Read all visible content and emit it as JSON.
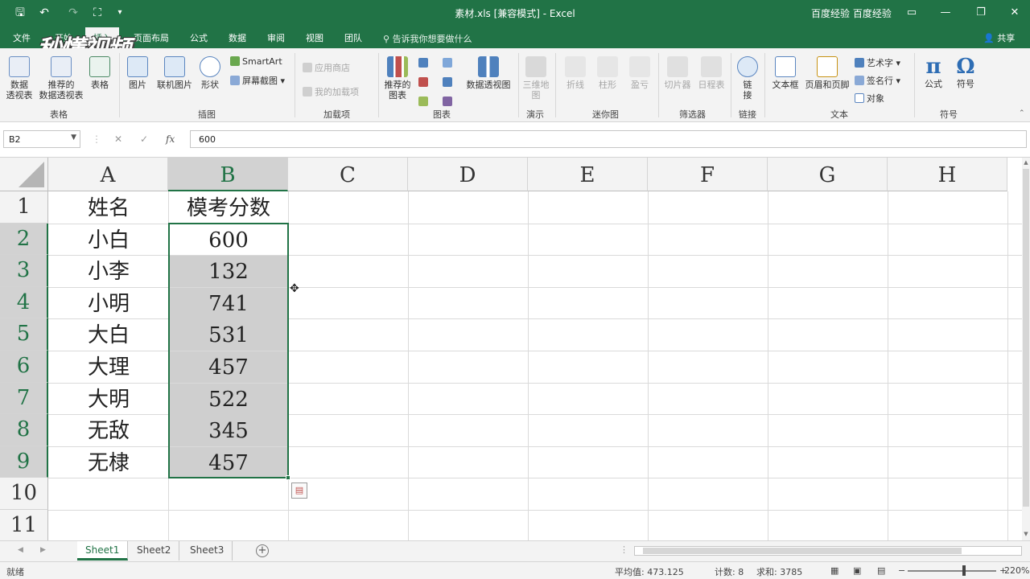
{
  "titlebar": {
    "title": "素材.xls  [兼容模式]  -  Excel",
    "user": "百度经验 百度经验",
    "quick_access": {
      "save": "🖫",
      "undo": "↶",
      "redo": "↷",
      "touch": "⛶",
      "customize": "▾"
    },
    "window": {
      "ribbon_options": "▭",
      "minimize": "—",
      "restore": "❐",
      "close": "✕"
    }
  },
  "logo_text": "秒懂视频",
  "tabs": [
    {
      "label": "文件"
    },
    {
      "label": "开始"
    },
    {
      "label": "插入"
    },
    {
      "label": "页面布局"
    },
    {
      "label": "公式"
    },
    {
      "label": "数据"
    },
    {
      "label": "审阅"
    },
    {
      "label": "视图"
    },
    {
      "label": "团队"
    }
  ],
  "tell_me": "告诉我你想要做什么",
  "share": "共享",
  "ribbon": {
    "pivot_table": "数据\n透视表",
    "recommended_pivot": "推荐的\n数据透视表",
    "table": "表格",
    "pictures": "图片",
    "online_pictures": "联机图片",
    "shapes": "形状",
    "smartart": "SmartArt",
    "screenshot": "屏幕截图 ▾",
    "app_store": "应用商店",
    "my_addins": "我的加载项",
    "recommended_charts": "推荐的\n图表",
    "pivot_chart": "数据透视图",
    "map_3d": "三维地\n图",
    "sparkline_line": "折线",
    "sparkline_column": "柱形",
    "sparkline_winloss": "盈亏",
    "slicer": "切片器",
    "timeline": "日程表",
    "link": "链\n接",
    "textbox": "文本框",
    "header_footer": "页眉和页脚",
    "wordart": "艺术字 ▾",
    "signature": "签名行 ▾",
    "object": "对象",
    "equation": "公式",
    "symbol": "符号",
    "equation_glyph": "π",
    "symbol_glyph": "Ω",
    "groups": {
      "tables": "表格",
      "illustrations": "插图",
      "addins": "加载项",
      "charts": "图表",
      "tours": "演示",
      "sparklines": "迷你图",
      "filters": "筛选器",
      "links": "链接",
      "text": "文本",
      "symbols": "符号"
    }
  },
  "formula_bar": {
    "name_box": "B2",
    "value": "600",
    "cancel": "✕",
    "enter": "✓",
    "fx": "fx"
  },
  "columns": [
    "A",
    "B",
    "C",
    "D",
    "E",
    "F",
    "G",
    "H"
  ],
  "rows": [
    "1",
    "2",
    "3",
    "4",
    "5",
    "6",
    "7",
    "8",
    "9",
    "10",
    "11"
  ],
  "cells": {
    "A1": "姓名",
    "B1": "模考分数",
    "A2": "小白",
    "B2": "600",
    "A3": "小李",
    "B3": "132",
    "A4": "小明",
    "B4": "741",
    "A5": "大白",
    "B5": "531",
    "A6": "大理",
    "B6": "457",
    "A7": "大明",
    "B7": "522",
    "A8": "无敌",
    "B8": "345",
    "A9": "无棣",
    "B9": "457"
  },
  "sheets": [
    {
      "label": "Sheet1",
      "active": true
    },
    {
      "label": "Sheet2"
    },
    {
      "label": "Sheet3"
    }
  ],
  "status": {
    "mode": "就绪",
    "average": "平均值: 473.125",
    "count": "计数: 8",
    "sum": "求和: 3785",
    "zoom": "220%",
    "zoom_minus": "−",
    "zoom_plus": "+"
  },
  "colors": {
    "accent": "#217346",
    "selection_fill": "#cfcfcf",
    "header_bg": "#f3f3f3"
  }
}
